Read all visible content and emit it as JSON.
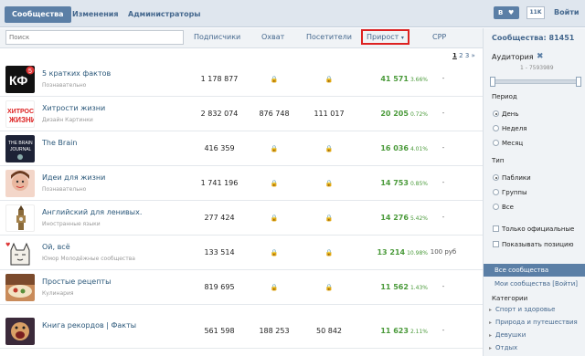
{
  "tabs": [
    {
      "label": "Сообщества"
    },
    {
      "label": "Изменения"
    },
    {
      "label": "Администраторы"
    }
  ],
  "topright": {
    "vk_label": "В",
    "heart_icon": "heart-icon",
    "count": "11K",
    "login": "Войти"
  },
  "search": {
    "placeholder": "Поиск"
  },
  "columns": {
    "subscribers": "Подписчики",
    "reach": "Охват",
    "visitors": "Посетители",
    "growth": "Прирост",
    "cpp": "CPP"
  },
  "pager": {
    "current": "1",
    "p2": "2",
    "p3": "3",
    "next": "»"
  },
  "rows": [
    {
      "name": "5 кратких фактов",
      "category": "Познавательно",
      "subs": "1 178 877",
      "reach": "",
      "visitors": "",
      "growth": "41 571",
      "pct": "3.66%",
      "cpp": "-"
    },
    {
      "name": "Хитрости жизни",
      "category": "Дизайн Картинки",
      "subs": "2 832 074",
      "reach": "876 748",
      "visitors": "111 017",
      "growth": "20 205",
      "pct": "0.72%",
      "cpp": "-"
    },
    {
      "name": "The Brain",
      "category": "",
      "subs": "416 359",
      "reach": "",
      "visitors": "",
      "growth": "16 036",
      "pct": "4.01%",
      "cpp": "-"
    },
    {
      "name": "Идеи для жизни",
      "category": "Познавательно",
      "subs": "1 741 196",
      "reach": "",
      "visitors": "",
      "growth": "14 753",
      "pct": "0.85%",
      "cpp": "-"
    },
    {
      "name": "Английский для ленивых.",
      "category": "Иностранные языки",
      "subs": "277 424",
      "reach": "",
      "visitors": "",
      "growth": "14 276",
      "pct": "5.42%",
      "cpp": "-"
    },
    {
      "name": "Ой, всё",
      "category": "Юмор Молодёжные сообщества",
      "subs": "133 514",
      "reach": "",
      "visitors": "",
      "growth": "13 214",
      "pct": "10.98%",
      "cpp": "100 руб"
    },
    {
      "name": "Простые рецепты",
      "category": "Кулинария",
      "subs": "819 695",
      "reach": "",
      "visitors": "",
      "growth": "11 562",
      "pct": "1.43%",
      "cpp": "-"
    },
    {
      "name": "Книга рекордов | Факты",
      "category": "",
      "subs": "561 598",
      "reach": "188 253",
      "visitors": "50 842",
      "growth": "11 623",
      "pct": "2.11%",
      "cpp": "-"
    }
  ],
  "sidebar": {
    "total": "Сообщества: 81451",
    "audience": "Аудитория",
    "range_min": "1",
    "range_max": "7593989",
    "period_label": "Период",
    "period": [
      "День",
      "Неделя",
      "Месяц"
    ],
    "type_label": "Тип",
    "types": [
      "Паблики",
      "Группы",
      "Все"
    ],
    "official": "Только официальные",
    "show_position": "Показывать позицию",
    "all_communities": "Все сообщества",
    "my_communities": "Мои сообщества [Войти]",
    "categories_label": "Категории",
    "categories": [
      "Спорт и здоровье",
      "Природа и путешествия",
      "Девушки",
      "Отдых"
    ]
  },
  "colors": {
    "accent": "#5b7fa6",
    "growth": "#4a9a3a",
    "highlight": "#dd2222"
  }
}
